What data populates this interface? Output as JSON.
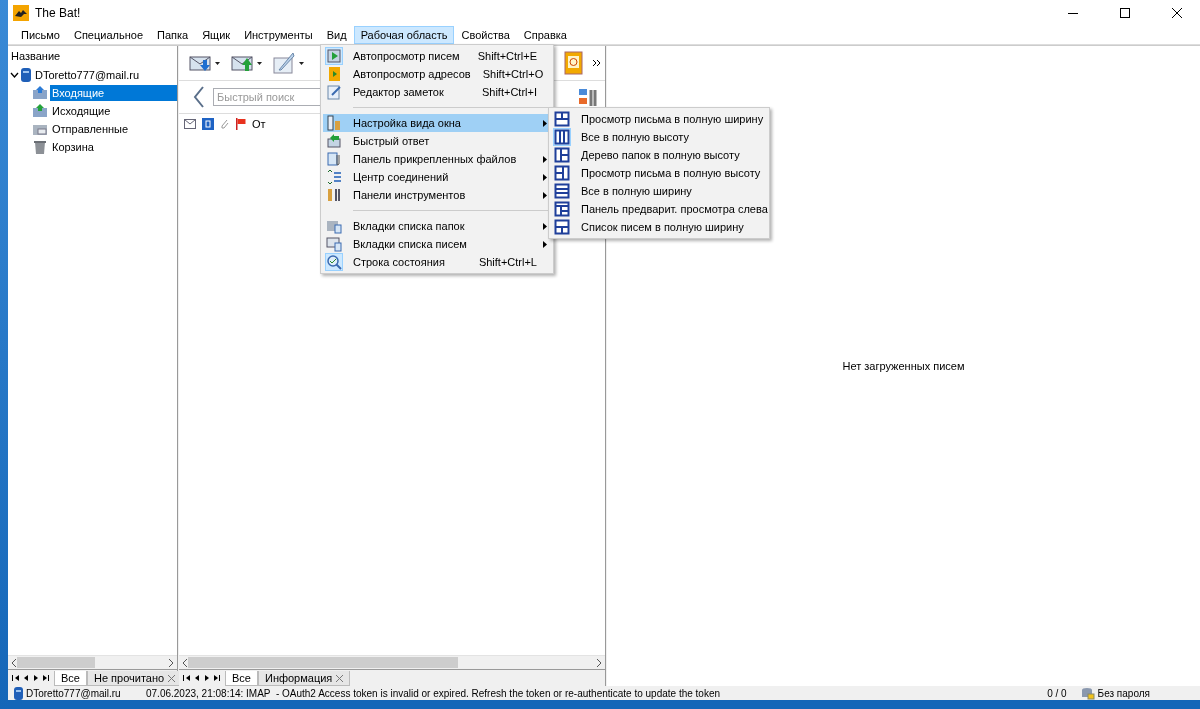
{
  "window": {
    "title": "The Bat!"
  },
  "menu_bar": [
    {
      "label": "Письмо",
      "selected": false
    },
    {
      "label": "Специальное",
      "selected": false
    },
    {
      "label": "Папка",
      "selected": false
    },
    {
      "label": "Ящик",
      "selected": false
    },
    {
      "label": "Инструменты",
      "selected": false
    },
    {
      "label": "Вид",
      "selected": false
    },
    {
      "label": "Рабочая область",
      "selected": true
    },
    {
      "label": "Свойства",
      "selected": false
    },
    {
      "label": "Справка",
      "selected": false
    }
  ],
  "folder_tree": {
    "header": "Название",
    "account": {
      "label": "DToretto777@mail.ru",
      "expanded": true,
      "children": [
        {
          "label": "Входящие",
          "selected": true
        },
        {
          "label": "Исходящие",
          "selected": false
        },
        {
          "label": "Отправленные",
          "selected": false
        },
        {
          "label": "Корзина",
          "selected": false
        }
      ]
    }
  },
  "quick_search": {
    "placeholder": "Быстрый поиск"
  },
  "message_list": {
    "columns": [
      {
        "label": "От"
      }
    ]
  },
  "preview": {
    "empty_text": "Нет загруженных писем"
  },
  "folder_tabs": [
    {
      "label": "Все",
      "selected": true,
      "closable": false
    },
    {
      "label": "Не прочитано",
      "selected": false,
      "closable": true
    }
  ],
  "message_tabs": [
    {
      "label": "Все",
      "selected": true,
      "closable": false
    },
    {
      "label": "Информация",
      "selected": false,
      "closable": true
    }
  ],
  "workspace_menu": [
    {
      "kind": "item",
      "label": "Автопросмотр писем",
      "shortcut": "Shift+Ctrl+E",
      "checked": true,
      "selected": false,
      "submenu": false
    },
    {
      "kind": "item",
      "label": "Автопросмотр адресов",
      "shortcut": "Shift+Ctrl+O",
      "checked": false,
      "selected": false,
      "submenu": false
    },
    {
      "kind": "item",
      "label": "Редактор заметок",
      "shortcut": "Shift+Ctrl+I",
      "checked": false,
      "selected": false,
      "submenu": false
    },
    {
      "kind": "separator"
    },
    {
      "kind": "item",
      "label": "Настройка вида окна",
      "checked": false,
      "selected": true,
      "submenu": true
    },
    {
      "kind": "item",
      "label": "Быстрый ответ",
      "checked": false,
      "selected": false,
      "submenu": false
    },
    {
      "kind": "item",
      "label": "Панель прикрепленных файлов",
      "checked": false,
      "selected": false,
      "submenu": true
    },
    {
      "kind": "item",
      "label": "Центр соединений",
      "checked": false,
      "selected": false,
      "submenu": true
    },
    {
      "kind": "item",
      "label": "Панели инструментов",
      "checked": false,
      "selected": false,
      "submenu": true
    },
    {
      "kind": "separator"
    },
    {
      "kind": "item",
      "label": "Вкладки списка папок",
      "checked": false,
      "selected": false,
      "submenu": true
    },
    {
      "kind": "item",
      "label": "Вкладки списка писем",
      "checked": false,
      "selected": false,
      "submenu": true
    },
    {
      "kind": "item",
      "label": "Строка состояния",
      "shortcut": "Shift+Ctrl+L",
      "checked": true,
      "selected": false,
      "submenu": false
    }
  ],
  "layout_submenu": [
    {
      "label": "Просмотр письма в полную ширину",
      "checked": false
    },
    {
      "label": "Все в полную высоту",
      "checked": true
    },
    {
      "label": "Дерево папок в полную высоту",
      "checked": false
    },
    {
      "label": "Просмотр письма в полную высоту",
      "checked": false
    },
    {
      "label": "Все в полную ширину",
      "checked": false
    },
    {
      "label": "Панель предварит. просмотра слева",
      "checked": false
    },
    {
      "label": "Список писем в полную ширину",
      "checked": false
    }
  ],
  "status_bar": {
    "account": "DToretto777@mail.ru",
    "message": "07.06.2023, 21:08:14: IMAP  - OAuth2 Access token is invalid or expired. Refresh the token or re-authenticate to update the token",
    "counts": "0 / 0",
    "encryption": "Без пароля"
  }
}
